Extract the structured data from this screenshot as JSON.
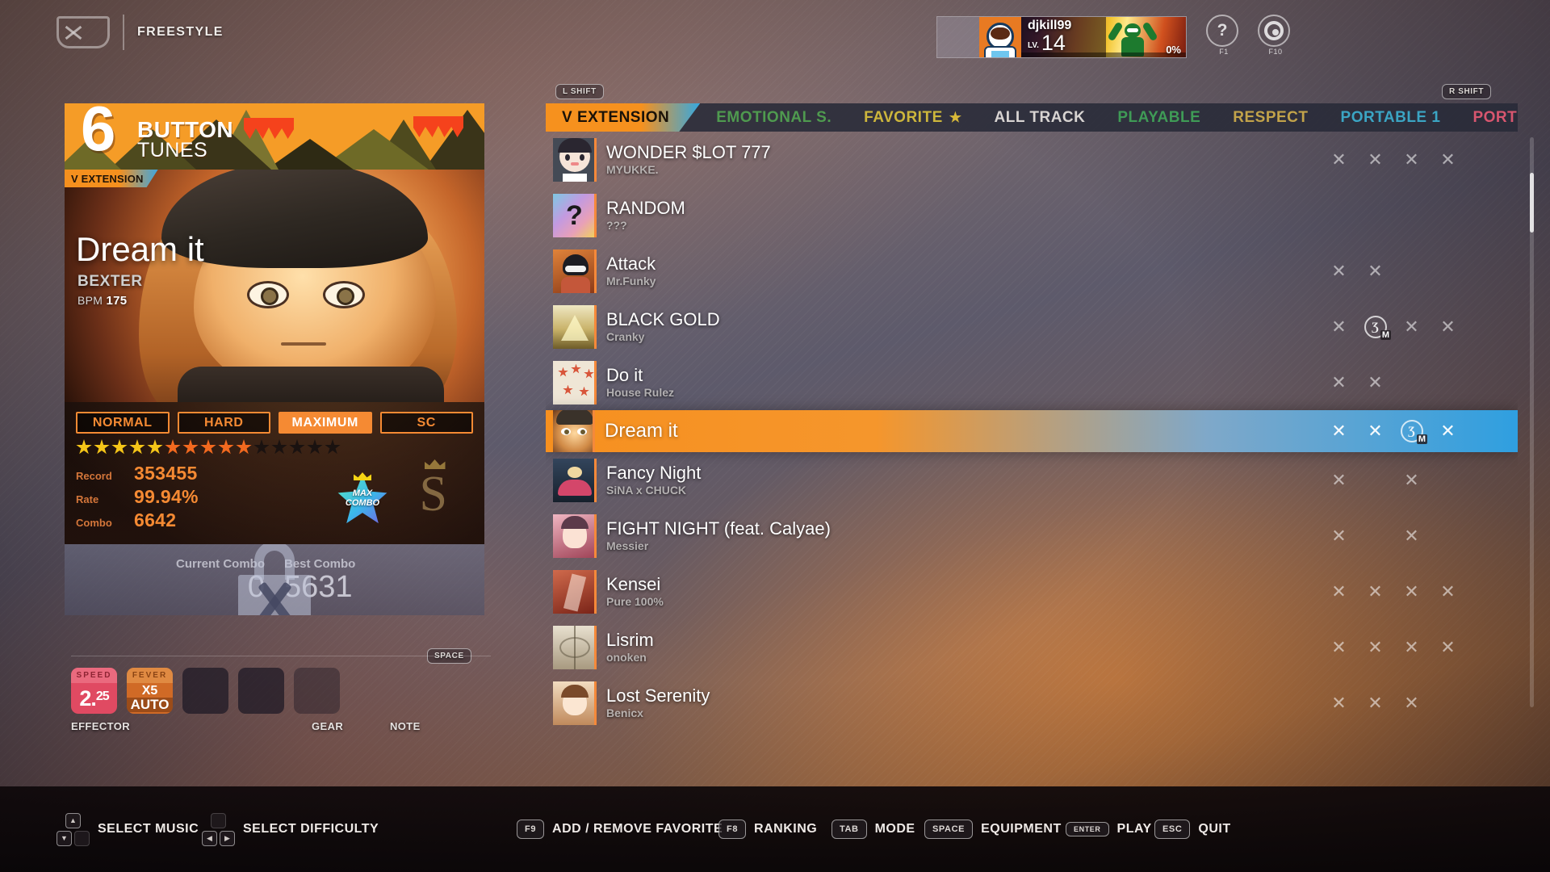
{
  "header": {
    "mode_label": "FREESTYLE",
    "help_key": "F1",
    "help_glyph": "?",
    "settings_key": "F10"
  },
  "profile": {
    "name": "djkill99",
    "lv_label": "LV.",
    "level": "14",
    "percent": "0%"
  },
  "hints": {
    "l_shift": "L SHIFT",
    "r_shift": "R SHIFT",
    "tab": "TAB",
    "space": "SPACE"
  },
  "card": {
    "mode_number": "6",
    "mode_button": "BUTTON",
    "mode_tunes": "TUNES",
    "genre": "V EXTENSION",
    "title": "Dream it",
    "artist": "BEXTER",
    "bpm_label": "BPM",
    "bpm_value": "175",
    "difficulties": [
      {
        "label": "NORMAL",
        "active": false
      },
      {
        "label": "HARD",
        "active": false
      },
      {
        "label": "MAXIMUM",
        "active": true
      },
      {
        "label": "SC",
        "active": false
      }
    ],
    "stars": {
      "total": 15,
      "yellow": 5,
      "orange": 5,
      "yellow_color": "#f5c518",
      "orange_color": "#f2691f",
      "empty_color": "#1a1210"
    },
    "score": [
      {
        "label": "Record",
        "value": "353455"
      },
      {
        "label": "Rate",
        "value": "99.94%"
      },
      {
        "label": "Combo",
        "value": "6642"
      }
    ],
    "badge_max": "MAX",
    "badge_combo": "COMBO",
    "rank_glyph": "S",
    "current_combo_label": "Current Combo",
    "current_combo_value": "0",
    "best_combo_label": "Best Combo",
    "best_combo_value": "5631"
  },
  "effector": {
    "speed_cap": "SPEED",
    "speed_int": "2.",
    "speed_frac": "25",
    "fever_cap": "FEVER",
    "fever_mult": "X5",
    "fever_auto": "AUTO",
    "label_effector": "EFFECTOR",
    "label_gear": "GEAR",
    "label_note": "NOTE"
  },
  "tabs": [
    {
      "label": "V EXTENSION",
      "color": "#1a1208",
      "active": true,
      "star": false
    },
    {
      "label": "EMOTIONAL S.",
      "color": "#4f9a4f",
      "active": false,
      "star": false
    },
    {
      "label": "FAVORITE",
      "color": "#cdb63c",
      "active": false,
      "star": true
    },
    {
      "label": "ALL TRACK",
      "color": "#d8d4d2",
      "active": false,
      "star": false
    },
    {
      "label": "PLAYABLE",
      "color": "#3f9b56",
      "active": false,
      "star": false
    },
    {
      "label": "RESPECT",
      "color": "#c2a34a",
      "active": false,
      "star": false
    },
    {
      "label": "PORTABLE 1",
      "color": "#3ba5c4",
      "active": false,
      "star": false
    },
    {
      "label": "PORT",
      "color": "#d8566f",
      "active": false,
      "star": false
    }
  ],
  "favorite_star_glyph": "★",
  "mark_glyph": "✕",
  "songs": [
    {
      "name": "WONDER $LOT 777",
      "artist": "MYUKKE.",
      "selected": false,
      "thumb": {
        "bg": "#444a55",
        "kind": "face-dark"
      },
      "marks": [
        "x",
        "x",
        "x",
        "x"
      ]
    },
    {
      "name": "RANDOM",
      "artist": "???",
      "selected": false,
      "thumb": {
        "bg": "#8d6fc0",
        "kind": "question"
      },
      "marks": []
    },
    {
      "name": "Attack",
      "artist": "Mr.Funky",
      "selected": false,
      "thumb": {
        "bg": "#c0642c",
        "kind": "masked"
      },
      "marks": [
        "x",
        "x",
        "",
        ""
      ]
    },
    {
      "name": "BLACK GOLD",
      "artist": "Cranky",
      "selected": false,
      "thumb": {
        "bg": "#d9cc8a",
        "kind": "gold"
      },
      "marks": [
        "x",
        "medal",
        "x",
        "x"
      ],
      "medal_badge": "M"
    },
    {
      "name": "Do it",
      "artist": "House Rulez",
      "selected": false,
      "thumb": {
        "bg": "#e7ddcd",
        "kind": "stars"
      },
      "marks": [
        "x",
        "x",
        "",
        ""
      ]
    },
    {
      "name": "Dream it",
      "artist": "",
      "selected": true,
      "thumb": {
        "bg": "#d89a62",
        "kind": "dream"
      },
      "marks": [
        "x",
        "x",
        "medal",
        "x"
      ],
      "medal_badge": "M"
    },
    {
      "name": "Fancy Night",
      "artist": "SiNA x CHUCK",
      "selected": false,
      "thumb": {
        "bg": "#2e3d4e",
        "kind": "night"
      },
      "marks": [
        "x",
        "",
        "x",
        ""
      ]
    },
    {
      "name": "FIGHT NIGHT (feat. Calyae)",
      "artist": "Messier",
      "selected": false,
      "thumb": {
        "bg": "#c97a8a",
        "kind": "fight"
      },
      "marks": [
        "x",
        "",
        "x",
        ""
      ]
    },
    {
      "name": "Kensei",
      "artist": "Pure 100%",
      "selected": false,
      "thumb": {
        "bg": "#b5503c",
        "kind": "kensei"
      },
      "marks": [
        "x",
        "x",
        "x",
        "x"
      ]
    },
    {
      "name": "Lisrim",
      "artist": "onoken",
      "selected": false,
      "thumb": {
        "bg": "#cfc2ad",
        "kind": "lisrim"
      },
      "marks": [
        "x",
        "x",
        "x",
        "x"
      ]
    },
    {
      "name": "Lost Serenity",
      "artist": "Benicx",
      "selected": false,
      "thumb": {
        "bg": "#e4c8a8",
        "kind": "serenity"
      },
      "marks": [
        "x",
        "x",
        "x",
        ""
      ]
    }
  ],
  "bottom_bar": [
    {
      "key_type": "updown",
      "label": "SELECT MUSIC"
    },
    {
      "key_type": "leftright",
      "label": "SELECT DIFFICULTY"
    },
    {
      "key_type": "cap",
      "key": "F9",
      "label": "ADD / REMOVE FAVORITE"
    },
    {
      "key_type": "cap",
      "key": "F8",
      "label": "RANKING"
    },
    {
      "key_type": "cap",
      "key": "TAB",
      "label": "MODE"
    },
    {
      "key_type": "cap",
      "key": "SPACE",
      "label": "EQUIPMENT"
    },
    {
      "key_type": "enter",
      "key": "ENTER",
      "label": "PLAY"
    },
    {
      "key_type": "cap",
      "key": "ESC",
      "label": "QUIT"
    }
  ]
}
